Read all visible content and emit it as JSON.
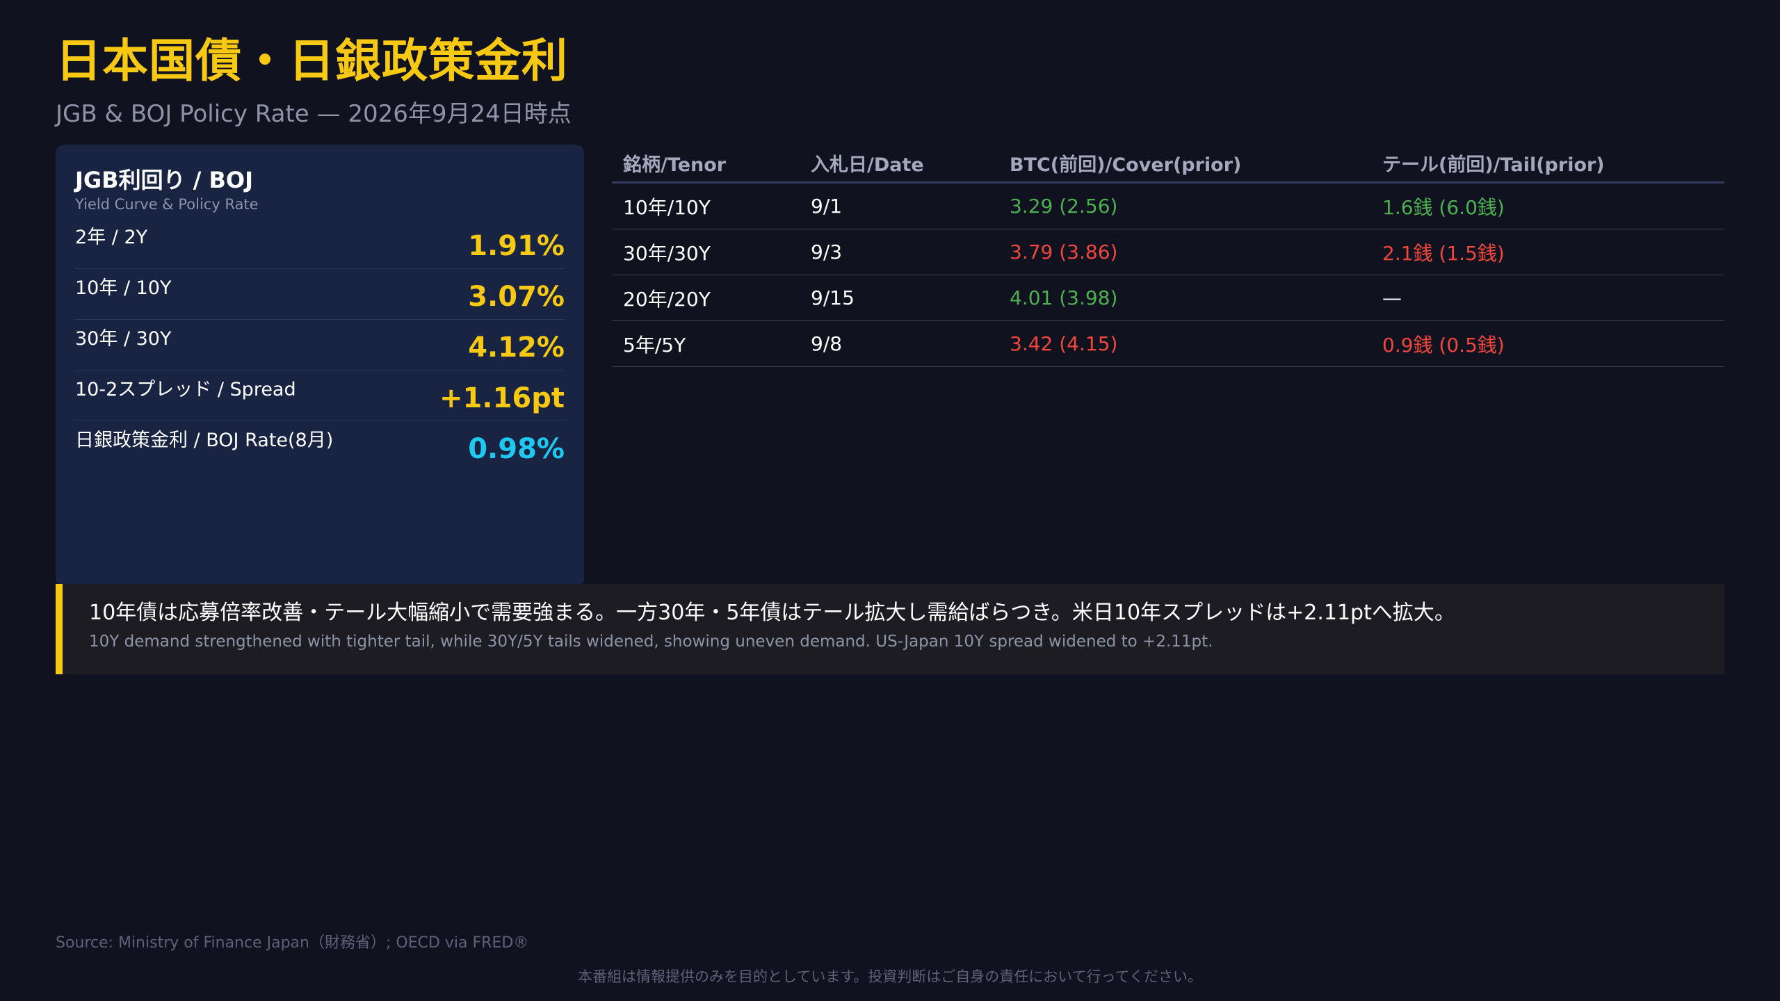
{
  "header": {
    "title": "日本国債・日銀政策金利",
    "subtitle": "JGB & BOJ Policy Rate — 2026年9月24日時点"
  },
  "card": {
    "title": "JGB利回り / BOJ",
    "subtitle": "Yield Curve & Policy Rate",
    "rows": [
      {
        "label": "2年 / 2Y",
        "value": "1.91%",
        "color": "#f7c913"
      },
      {
        "label": "10年 / 10Y",
        "value": "3.07%",
        "color": "#f7c913"
      },
      {
        "label": "30年 / 30Y",
        "value": "4.12%",
        "color": "#f7c913"
      },
      {
        "label": "10-2スプレッド / Spread",
        "value": "+1.16pt",
        "color": "#f7c913"
      },
      {
        "label": "日銀政策金利 / BOJ Rate(8月)",
        "value": "0.98%",
        "color": "#1ec8f0"
      }
    ]
  },
  "auction_table": {
    "headers": [
      "銘柄/Tenor",
      "入札日/Date",
      "BTC(前回)/Cover(prior)",
      "テール(前回)/Tail(prior)"
    ],
    "rows": [
      {
        "tenor": "10年/10Y",
        "date": "9/1",
        "cover": "3.29 (2.56)",
        "cover_color": "#4caf50",
        "tail": "1.6銭 (6.0銭)",
        "tail_color": "#4caf50"
      },
      {
        "tenor": "30年/30Y",
        "date": "9/3",
        "cover": "3.79 (3.86)",
        "cover_color": "#f0463c",
        "tail": "2.1銭 (1.5銭)",
        "tail_color": "#f0463c"
      },
      {
        "tenor": "20年/20Y",
        "date": "9/15",
        "cover": "4.01 (3.98)",
        "cover_color": "#4caf50",
        "tail": "—",
        "tail_color": "#ffffff"
      },
      {
        "tenor": "5年/5Y",
        "date": "9/8",
        "cover": "3.42 (4.15)",
        "cover_color": "#f0463c",
        "tail": "0.9銭 (0.5銭)",
        "tail_color": "#f0463c"
      }
    ]
  },
  "commentary": {
    "jp": "10年債は応募倍率改善・テール大幅縮小で需要強まる。一方30年・5年債はテール拡大し需給ばらつき。米日10年スプレッドは+2.11ptへ拡大。",
    "en": "10Y demand strengthened with tighter tail, while 30Y/5Y tails widened, showing uneven demand. US-Japan 10Y spread widened to +2.11pt."
  },
  "footer": {
    "source": "Source: Ministry of Finance Japan（財務省）; OECD via FRED®",
    "disclaimer": "本番組は情報提供のみを目的としています。投資判断はご自身の責任において行ってください。"
  },
  "colors": {
    "accent": "#f7c913",
    "boj": "#1ec8f0",
    "positive": "#4caf50",
    "negative": "#f0463c",
    "background": "#11121f",
    "card": "#182442"
  }
}
